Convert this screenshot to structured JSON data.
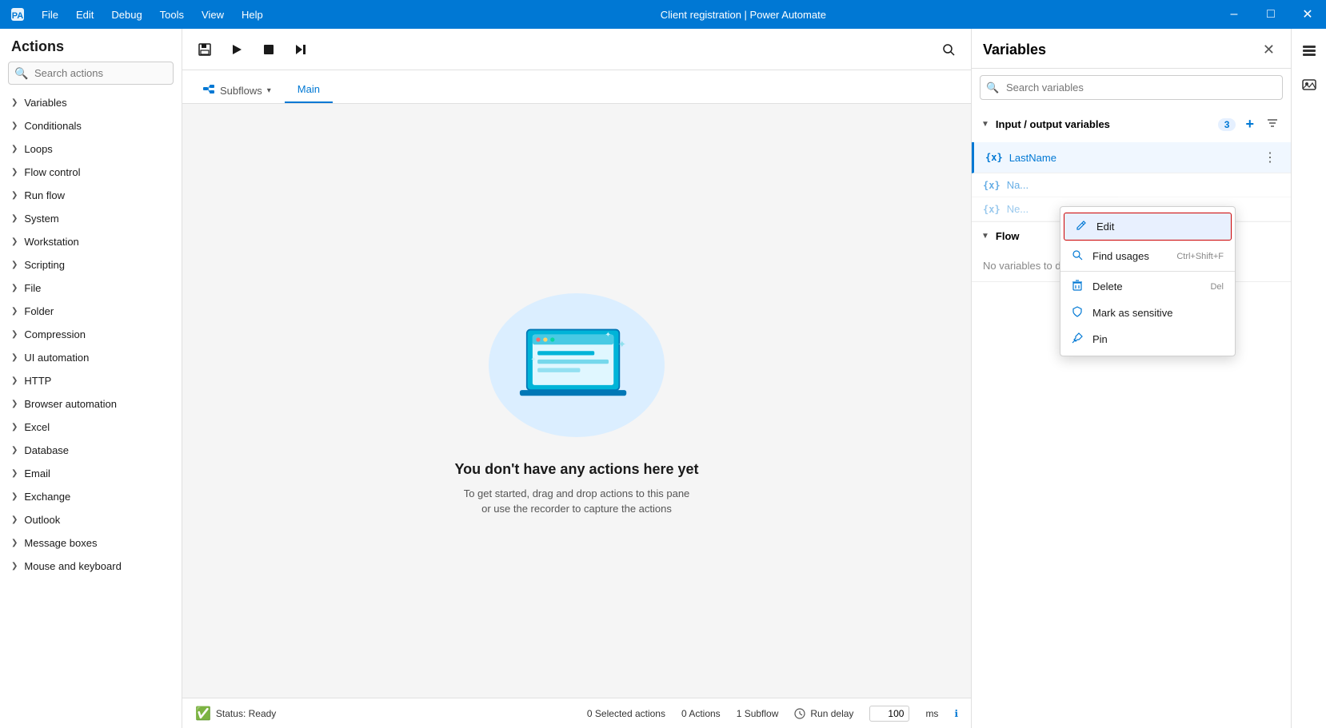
{
  "titleBar": {
    "title": "Client registration | Power Automate",
    "menus": [
      "File",
      "Edit",
      "Debug",
      "Tools",
      "View",
      "Help"
    ],
    "controls": [
      "–",
      "□",
      "×"
    ]
  },
  "actionsPanel": {
    "header": "Actions",
    "searchPlaceholder": "Search actions",
    "items": [
      "Variables",
      "Conditionals",
      "Loops",
      "Flow control",
      "Run flow",
      "System",
      "Workstation",
      "Scripting",
      "File",
      "Folder",
      "Compression",
      "UI automation",
      "HTTP",
      "Browser automation",
      "Excel",
      "Database",
      "Email",
      "Exchange",
      "Outlook",
      "Message boxes",
      "Mouse and keyboard"
    ]
  },
  "toolbar": {
    "buttons": [
      "save",
      "run",
      "stop",
      "step"
    ],
    "searchTitle": "Search"
  },
  "tabs": {
    "subflows": "Subflows",
    "main": "Main"
  },
  "canvas": {
    "title": "You don't have any actions here yet",
    "subtitle1": "To get started, drag and drop actions to this pane",
    "subtitle2": "or use the recorder to capture the actions"
  },
  "statusBar": {
    "status": "Status: Ready",
    "selectedActions": "0 Selected actions",
    "actions": "0 Actions",
    "subflow": "1 Subflow",
    "runDelay": "Run delay",
    "delayValue": "100",
    "ms": "ms"
  },
  "variablesPanel": {
    "header": "Variables",
    "searchPlaceholder": "Search variables",
    "inputOutputSection": {
      "title": "Input / output variables",
      "count": "3",
      "items": [
        {
          "name": "LastName",
          "type": "x"
        },
        {
          "name": "Na...",
          "type": "x"
        },
        {
          "name": "Ne...",
          "type": "x"
        }
      ]
    },
    "flowSection": {
      "title": "Flow",
      "noVarsText": "No variables to display"
    }
  },
  "contextMenu": {
    "items": [
      {
        "label": "Edit",
        "icon": "edit",
        "shortcut": ""
      },
      {
        "label": "Find usages",
        "icon": "search",
        "shortcut": "Ctrl+Shift+F"
      },
      {
        "label": "Delete",
        "icon": "delete",
        "shortcut": "Del"
      },
      {
        "label": "Mark as sensitive",
        "icon": "shield",
        "shortcut": ""
      },
      {
        "label": "Pin",
        "icon": "pin",
        "shortcut": ""
      }
    ]
  }
}
